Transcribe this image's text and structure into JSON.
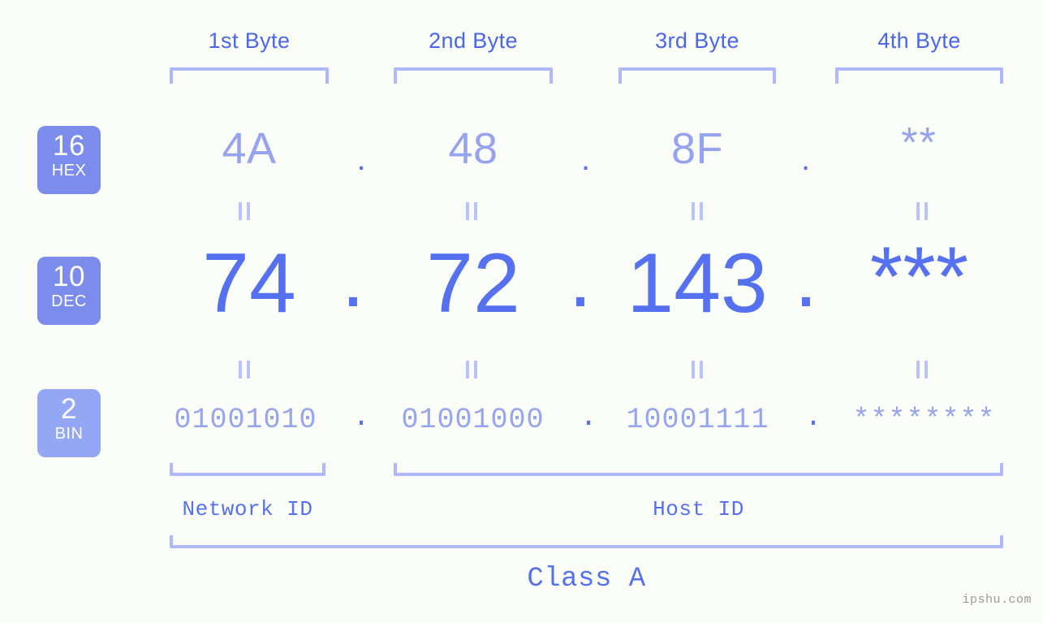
{
  "theme": {
    "background": "#fbfdf8",
    "accent_strong": "#5571ef",
    "accent_header": "#4a66ec",
    "accent_light": "#96a4f0",
    "bracket": "#aeb8fb",
    "badge_primary": "#7b8ced",
    "badge_secondary": "#94a7f5",
    "watermark": "#9a9a9a"
  },
  "headers": [
    {
      "label": "1st Byte"
    },
    {
      "label": "2nd Byte"
    },
    {
      "label": "3rd Byte"
    },
    {
      "label": "4th Byte"
    }
  ],
  "bases": [
    {
      "num": "16",
      "abbr": "HEX"
    },
    {
      "num": "10",
      "abbr": "DEC"
    },
    {
      "num": "2",
      "abbr": "BIN"
    }
  ],
  "separator": ".",
  "rows": {
    "hex": {
      "values": [
        "4A",
        "48",
        "8F",
        "**"
      ]
    },
    "dec": {
      "values": [
        "74",
        "72",
        "143",
        "***"
      ]
    },
    "bin": {
      "values": [
        "01001010",
        "01001000",
        "10001111",
        "********"
      ]
    }
  },
  "segments": {
    "network_id": "Network ID",
    "host_id": "Host ID",
    "class": "Class A"
  },
  "watermark": "ipshu.com"
}
